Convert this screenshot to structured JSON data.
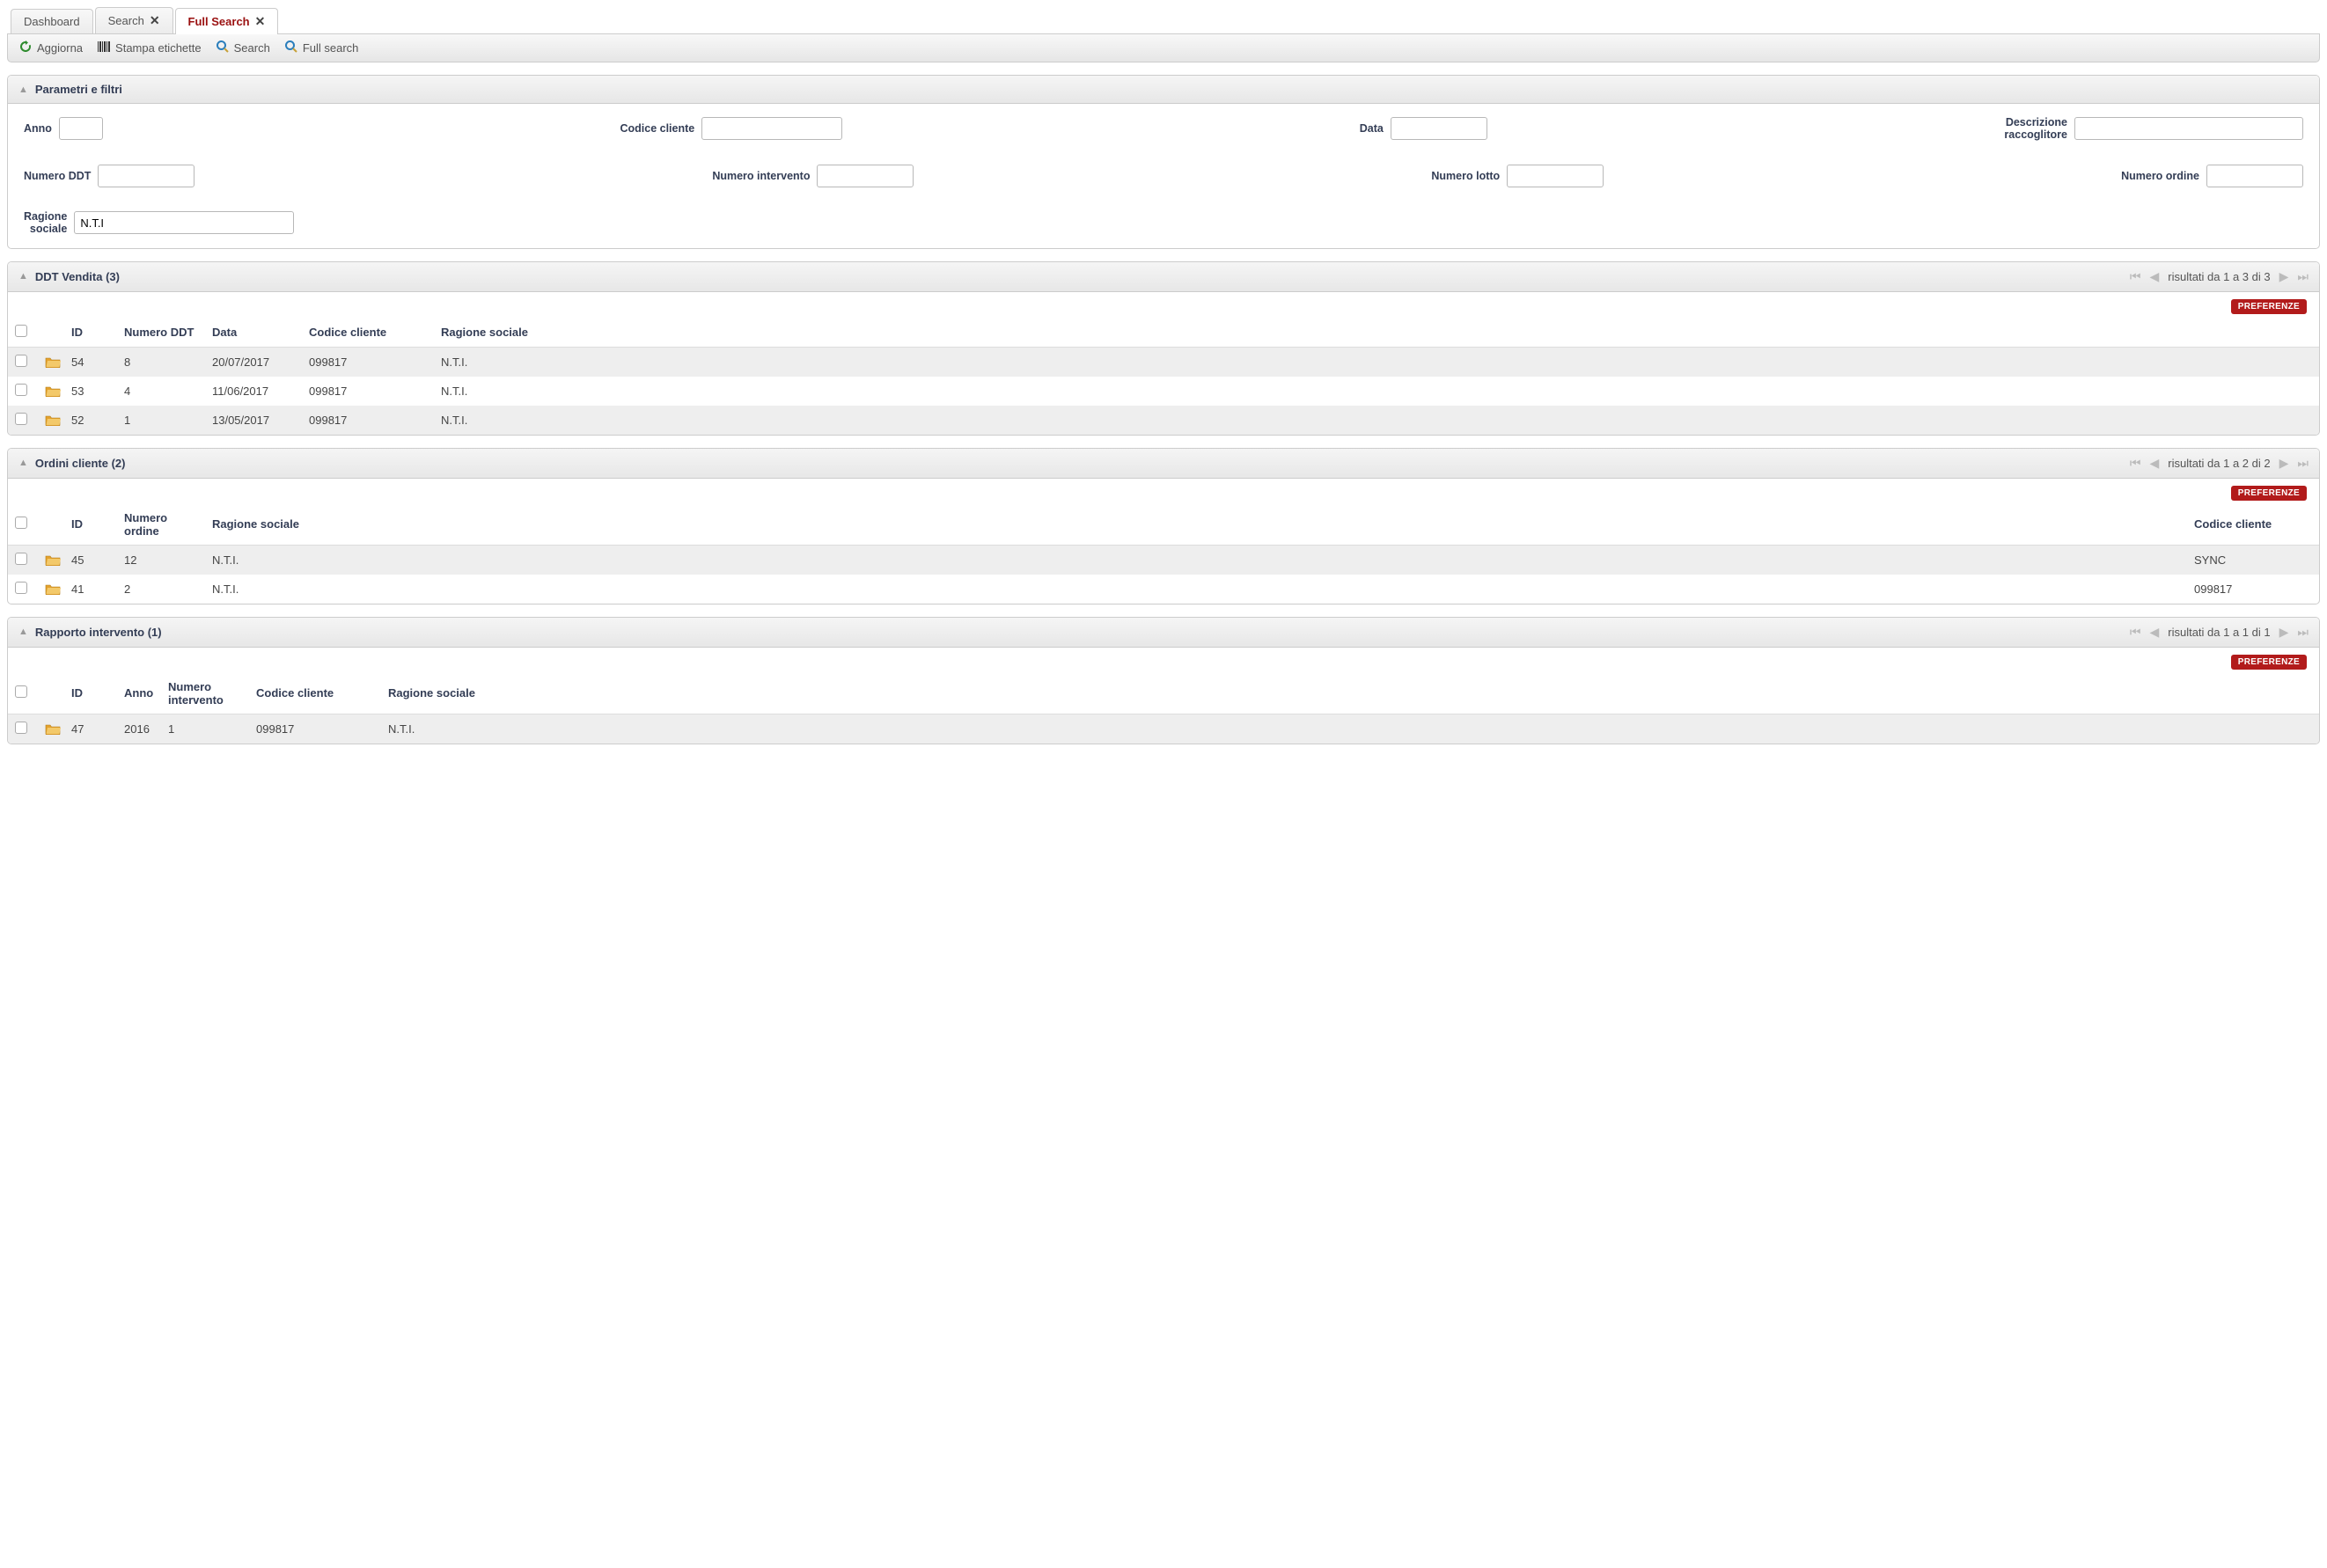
{
  "tabs": [
    {
      "label": "Dashboard",
      "closable": false,
      "active": false
    },
    {
      "label": "Search",
      "closable": true,
      "active": false
    },
    {
      "label": "Full Search",
      "closable": true,
      "active": true
    }
  ],
  "toolbar": {
    "refresh": "Aggiorna",
    "print_labels": "Stampa etichette",
    "search": "Search",
    "full_search": "Full search"
  },
  "filters": {
    "title": "Parametri e filtri",
    "labels": {
      "anno": "Anno",
      "codice_cliente": "Codice cliente",
      "data": "Data",
      "descr_raccoglitore_l1": "Descrizione",
      "descr_raccoglitore_l2": "raccoglitore",
      "numero_ddt": "Numero DDT",
      "numero_intervento": "Numero intervento",
      "numero_lotto": "Numero lotto",
      "numero_ordine": "Numero ordine",
      "ragione_sociale_l1": "Ragione",
      "ragione_sociale_l2": "sociale"
    },
    "values": {
      "anno": "",
      "codice_cliente": "",
      "data": "",
      "descr_raccoglitore": "",
      "numero_ddt": "",
      "numero_intervento": "",
      "numero_lotto": "",
      "numero_ordine": "",
      "ragione_sociale": "N.T.I"
    }
  },
  "ddt": {
    "title": "DDT Vendita (3)",
    "pager": "risultati da 1 a 3 di 3",
    "preferenze": "PREFERENZE",
    "headers": {
      "id": "ID",
      "num": "Numero DDT",
      "data": "Data",
      "cc": "Codice cliente",
      "rs": "Ragione sociale"
    },
    "rows": [
      {
        "id": "54",
        "num": "8",
        "data": "20/07/2017",
        "cc": "099817",
        "rs": "N.T.I."
      },
      {
        "id": "53",
        "num": "4",
        "data": "11/06/2017",
        "cc": "099817",
        "rs": "N.T.I."
      },
      {
        "id": "52",
        "num": "1",
        "data": "13/05/2017",
        "cc": "099817",
        "rs": "N.T.I."
      }
    ]
  },
  "ordini": {
    "title": "Ordini cliente (2)",
    "pager": "risultati da 1 a 2 di 2",
    "preferenze": "PREFERENZE",
    "headers": {
      "id": "ID",
      "num": "Numero ordine",
      "rs": "Ragione sociale",
      "cc": "Codice cliente"
    },
    "rows": [
      {
        "id": "45",
        "num": "12",
        "rs": "N.T.I.",
        "cc": "SYNC"
      },
      {
        "id": "41",
        "num": "2",
        "rs": "N.T.I.",
        "cc": "099817"
      }
    ]
  },
  "rapporto": {
    "title": "Rapporto intervento (1)",
    "pager": "risultati da 1 a 1 di 1",
    "preferenze": "PREFERENZE",
    "headers": {
      "id": "ID",
      "anno": "Anno",
      "numint_l1": "Numero",
      "numint_l2": "intervento",
      "cc": "Codice cliente",
      "rs": "Ragione sociale"
    },
    "rows": [
      {
        "id": "47",
        "anno": "2016",
        "numint": "1",
        "cc": "099817",
        "rs": "N.T.I."
      }
    ]
  }
}
